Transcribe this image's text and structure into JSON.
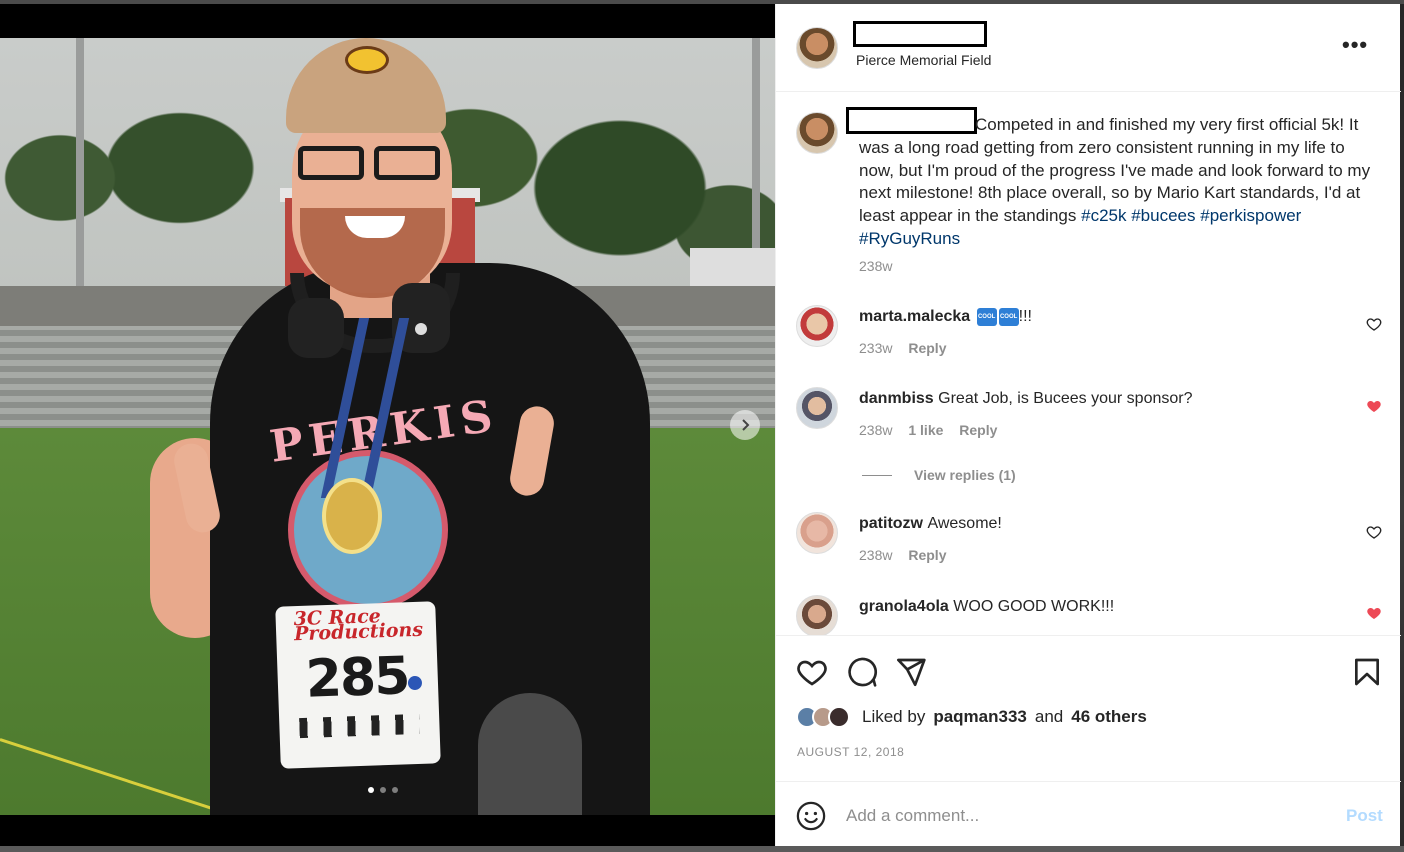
{
  "post": {
    "location": "Pierce Memorial Field",
    "more_label": "•••",
    "caption_text": "Competed in and finished my very first official 5k! It was a long road getting from zero consistent running in my life to now, but I'm proud of the progress I've made and look forward to my next milestone! 8th place overall, so by Mario Kart standards, I'd at least appear in the standings",
    "hashtags": [
      "#c25k",
      "#bucees",
      "#perkispower",
      "#RyGuyRuns"
    ],
    "caption_age": "238w",
    "image_text": {
      "shirt_text": "PERKIS",
      "bib_brand": "3C Race Productions",
      "bib_number": "285"
    },
    "carousel": {
      "next_icon": "chevron-right-icon",
      "slides": 3,
      "active_slide": 1
    }
  },
  "comments": [
    {
      "user": "marta.malecka",
      "text": "!!!",
      "emojis": [
        "COOL",
        "COOL"
      ],
      "age": "233w",
      "likes": "",
      "reply": "Reply",
      "liked": false
    },
    {
      "user": "danmbiss",
      "text": "Great Job, is Bucees your sponsor?",
      "age": "238w",
      "likes": "1 like",
      "reply": "Reply",
      "liked": true
    },
    {
      "user": "patitozw",
      "text": "Awesome!",
      "age": "238w",
      "likes": "",
      "reply": "Reply",
      "liked": false
    },
    {
      "user": "granola4ola",
      "text": "WOO GOOD WORK!!!",
      "age": "",
      "likes": "",
      "reply": "",
      "liked": true
    }
  ],
  "view_replies": "View replies (1)",
  "likes": {
    "prefix": "Liked by",
    "user": "paqman333",
    "and": "and",
    "others": "46 others"
  },
  "date": "AUGUST 12, 2018",
  "add_comment": {
    "placeholder": "Add a comment...",
    "post_label": "Post"
  },
  "colors": {
    "liked_heart": "#ed4956",
    "hashtag": "#00376b",
    "post_disabled": "#b3dbff"
  }
}
